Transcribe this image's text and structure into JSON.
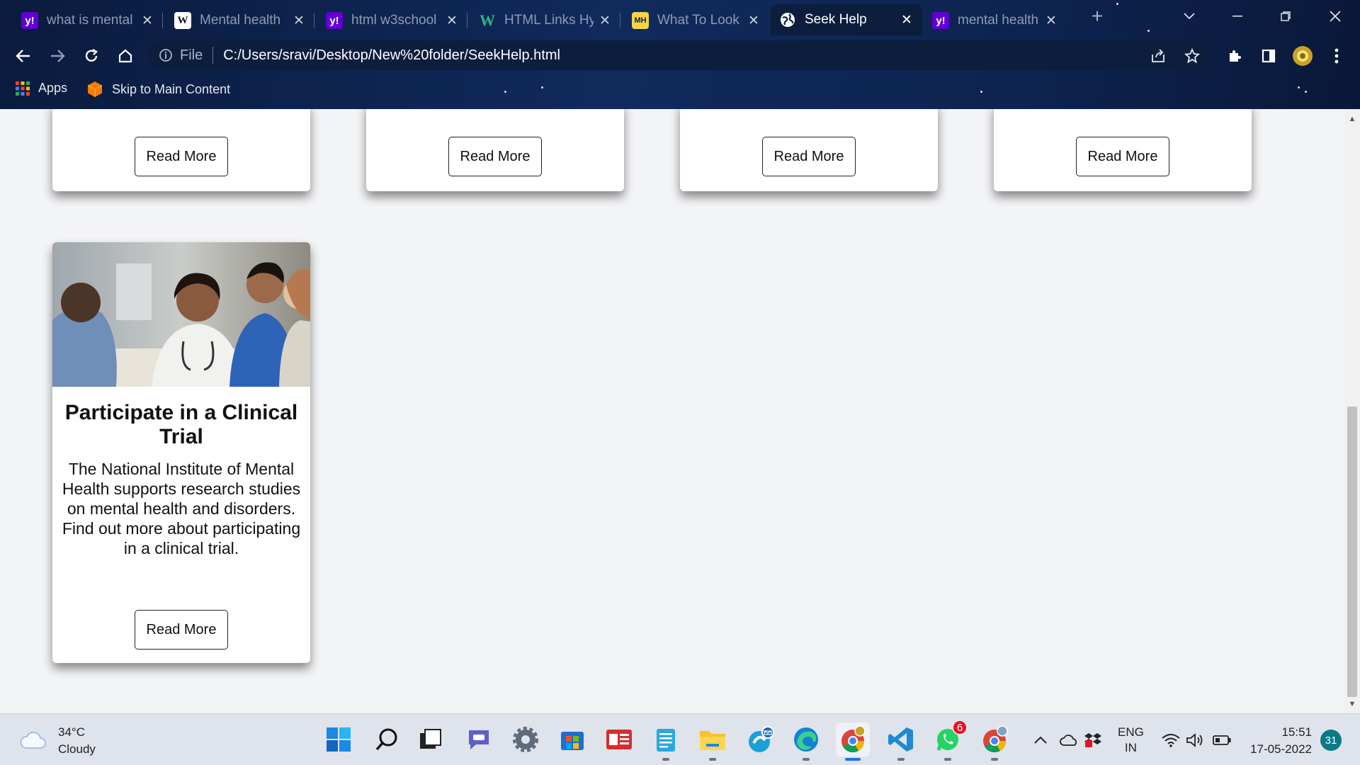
{
  "browser": {
    "tabs": [
      {
        "title": "what is mental",
        "favicon": "yahoo-icon",
        "favicon_text": "y!"
      },
      {
        "title": "Mental health",
        "favicon": "wikipedia-icon",
        "favicon_text": "W"
      },
      {
        "title": "html w3school",
        "favicon": "yahoo-icon",
        "favicon_text": "y!"
      },
      {
        "title": "HTML Links Hy",
        "favicon": "w3schools-icon",
        "favicon_text": "W"
      },
      {
        "title": "What To Look",
        "favicon": "mentalhealth-gov-icon",
        "favicon_text": "MH"
      },
      {
        "title": "Seek Help",
        "favicon": "globe-icon",
        "favicon_text": ""
      },
      {
        "title": "mental health",
        "favicon": "yahoo-icon",
        "favicon_text": "y!"
      }
    ],
    "active_tab_index": 5,
    "address": {
      "scheme_label": "File",
      "url": "C:/Users/sravi/Desktop/New%20folder/SeekHelp.html"
    },
    "bookmarks": [
      {
        "label": "Apps",
        "icon": "apps-grid-icon"
      },
      {
        "label": "Skip to Main Content",
        "icon": "cube-icon"
      }
    ]
  },
  "page": {
    "top_cards": [
      {
        "button_label": "Read More"
      },
      {
        "button_label": "Read More"
      },
      {
        "button_label": "Read More"
      },
      {
        "button_label": "Read More"
      }
    ],
    "featured_card": {
      "title": "Participate in a Clinical Trial",
      "body": "The National Institute of Mental Health supports research studies on mental health and disorders. Find out more about participating in a clinical trial.",
      "button_label": "Read More",
      "image": "photo of medical staff in consultation"
    }
  },
  "taskbar": {
    "weather": {
      "temp": "34°C",
      "condition": "Cloudy"
    },
    "apps": [
      "start-icon",
      "search-icon",
      "task-view-icon",
      "teams-chat-icon",
      "settings-icon",
      "store-icon",
      "news-icon",
      "notepad-icon",
      "file-explorer-icon",
      "edge-mail-icon",
      "edge-icon",
      "chrome-icon",
      "vscode-icon",
      "whatsapp-icon",
      "chrome-profile-icon"
    ],
    "whatsapp_badge": "6",
    "language": {
      "line1": "ENG",
      "line2": "IN"
    },
    "time": "15:51",
    "date": "17-05-2022",
    "notification_count": "31"
  },
  "colors": {
    "accent": "#1a73e8",
    "page_bg": "#f3f4f6",
    "chrome_bg": "#102a5c",
    "yahoo": "#6001d2"
  }
}
